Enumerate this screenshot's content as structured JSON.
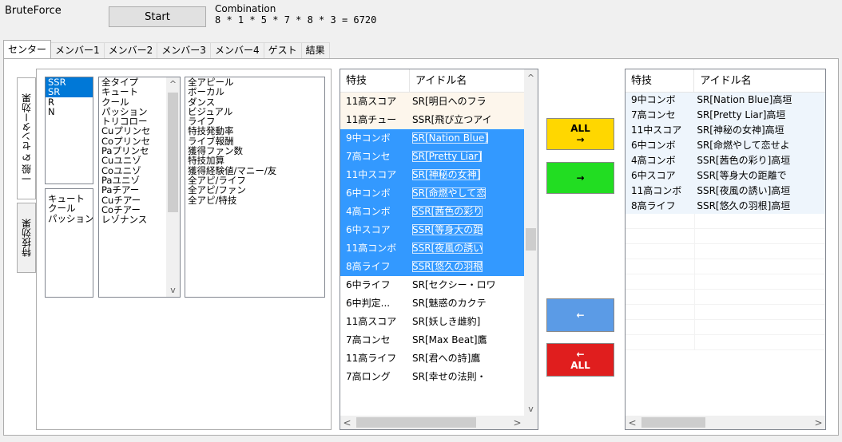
{
  "app": {
    "title": "BruteForce"
  },
  "header": {
    "start_label": "Start",
    "combination_label": "Combination",
    "combination_value": "8 * 1 * 5 * 7 * 8 * 3 = 6720"
  },
  "tabs": [
    "センター",
    "メンバー1",
    "メンバー2",
    "メンバー3",
    "メンバー4",
    "ゲスト",
    "結果"
  ],
  "vertical_tabs": [
    "一般 & センター効果",
    "特技効果"
  ],
  "filters": {
    "rarity": [
      "SSR",
      "SR",
      "R",
      "N"
    ],
    "type_filter": [
      "キュート",
      "クール",
      "パッション"
    ],
    "skill_types": [
      "全タイプ",
      "キュート",
      "クール",
      "パッション",
      "トリコロー",
      "Cuプリンセ",
      "Coプリンセ",
      "Paプリンセ",
      "Cuユニゾ",
      "Coユニゾ",
      "Paユニゾ",
      "Paチアー",
      "Cuチアー",
      "Coチアー",
      "レゾナンス"
    ],
    "appeals": [
      "全アピール",
      "ボーカル",
      "ダンス",
      "ビジュアル",
      "ライフ",
      "特技発動率",
      "ライブ報酬",
      "獲得ファン数",
      "特技加算",
      "獲得経験値/マニー/友",
      "全アピ/ライフ",
      "全アピ/ファン",
      "全アピ/特技"
    ]
  },
  "candidate_list": {
    "col_skill": "特技",
    "col_idol": "アイドル名",
    "rows": [
      {
        "skill": "11高スコア",
        "idol": "SR[明日へのフラ",
        "state": "alt"
      },
      {
        "skill": "11高チュー",
        "idol": "SSR[飛び立つアイ",
        "state": "alt"
      },
      {
        "skill": "9中コンボ",
        "idol": "SR[Nation Blue]",
        "state": "sel"
      },
      {
        "skill": "7高コンセ",
        "idol": "SR[Pretty Liar]",
        "state": "sel"
      },
      {
        "skill": "11中スコア",
        "idol": "SR[神秘の女神]",
        "state": "sel"
      },
      {
        "skill": "6中コンボ",
        "idol": "SR[命燃やして恋",
        "state": "sel"
      },
      {
        "skill": "4高コンボ",
        "idol": "SSR[茜色の彩り",
        "state": "sel"
      },
      {
        "skill": "6中スコア",
        "idol": "SSR[等身大の距",
        "state": "sel"
      },
      {
        "skill": "11高コンボ",
        "idol": "SSR[夜風の誘い",
        "state": "sel"
      },
      {
        "skill": "8高ライフ",
        "idol": "SSR[悠久の羽根",
        "state": "sel"
      },
      {
        "skill": "6中ライフ",
        "idol": "SR[セクシー・ロワ",
        "state": ""
      },
      {
        "skill": "6中判定...",
        "idol": "SR[魅惑のカクテ",
        "state": ""
      },
      {
        "skill": "11高スコア",
        "idol": "SR[妖しき雌豹]",
        "state": ""
      },
      {
        "skill": "7高コンセ",
        "idol": "SR[Max Beat]鷹",
        "state": ""
      },
      {
        "skill": "11高ライフ",
        "idol": "SR[君への詩]鷹",
        "state": ""
      },
      {
        "skill": "7高ロング",
        "idol": "SR[幸せの法則・",
        "state": ""
      }
    ]
  },
  "buttons": {
    "all_right_top": "ALL",
    "all_right_arrow": "→",
    "right_arrow": "→",
    "left_arrow": "←",
    "all_left_arrow": "←",
    "all_left_bottom": "ALL"
  },
  "selected_list": {
    "col_skill": "特技",
    "col_idol": "アイドル名",
    "rows": [
      {
        "skill": "9中コンボ",
        "idol": "SR[Nation Blue]高垣"
      },
      {
        "skill": "7高コンセ",
        "idol": "SR[Pretty Liar]高垣"
      },
      {
        "skill": "11中スコア",
        "idol": "SR[神秘の女神]高垣"
      },
      {
        "skill": "6中コンボ",
        "idol": "SR[命燃やして恋せよ"
      },
      {
        "skill": "4高コンボ",
        "idol": "SSR[茜色の彩り]高垣"
      },
      {
        "skill": "6中スコア",
        "idol": "SSR[等身大の距離で"
      },
      {
        "skill": "11高コンボ",
        "idol": "SSR[夜風の誘い]高垣"
      },
      {
        "skill": "8高ライフ",
        "idol": "SSR[悠久の羽根]高垣"
      }
    ]
  },
  "scroll_glyphs": {
    "up": "^",
    "down": "v",
    "left": "<",
    "right": ">"
  },
  "colors": {
    "selection": "#3399ff",
    "list_selection": "#0078d7",
    "all_right": "#ffd700",
    "right": "#22dd22",
    "left": "#5b9be6",
    "all_left": "#e01e1e"
  }
}
